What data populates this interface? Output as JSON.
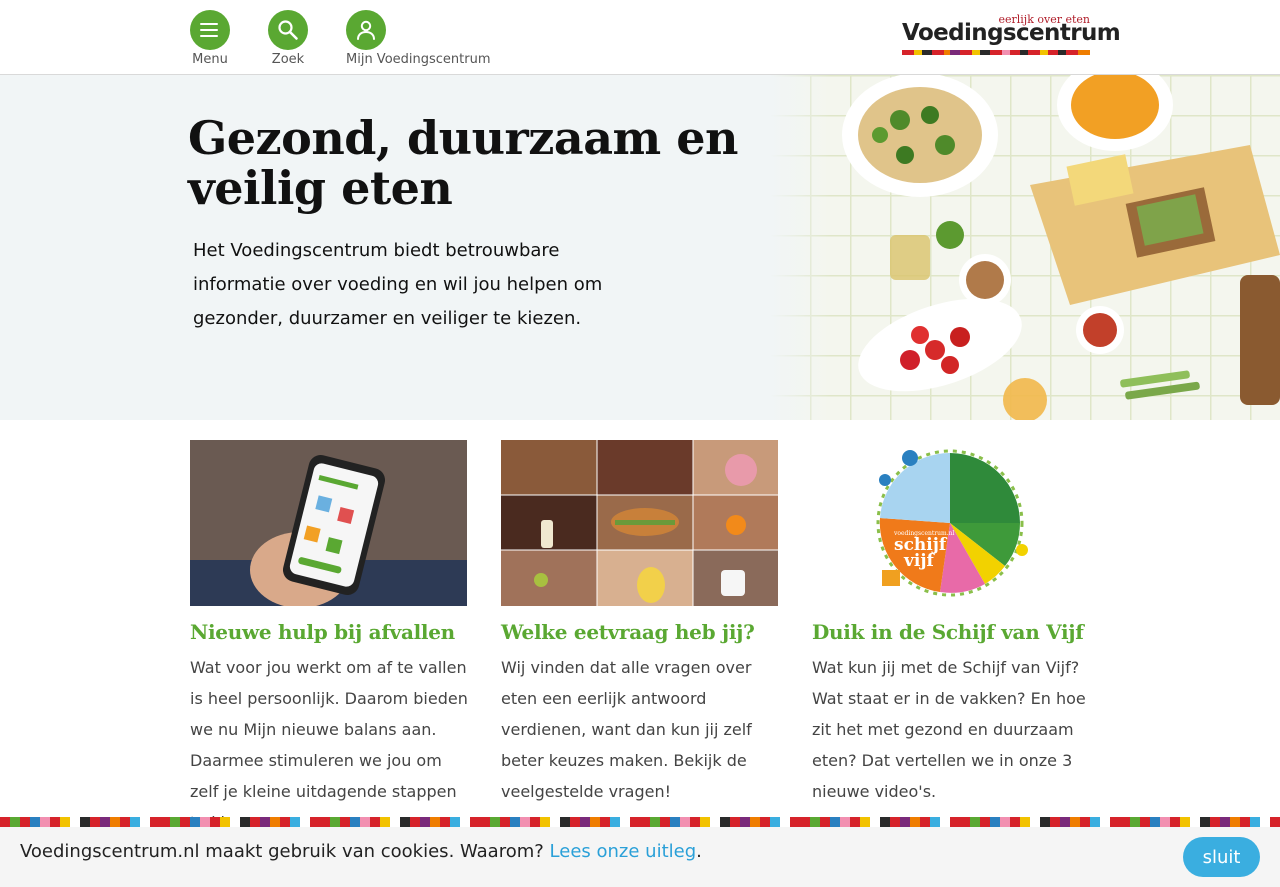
{
  "colors": {
    "brand_green": "#5aa832",
    "link_blue": "#2aa0d8",
    "button_blue": "#3aaee0",
    "logo_red": "#b01e2a"
  },
  "header": {
    "nav": [
      {
        "label": "Menu",
        "icon": "hamburger-icon"
      },
      {
        "label": "Zoek",
        "icon": "search-icon"
      },
      {
        "label": "Mijn Voedingscentrum",
        "icon": "user-icon"
      }
    ],
    "logo": {
      "tagline": "eerlijk over eten",
      "wordmark": "Voedingscentrum"
    }
  },
  "hero": {
    "title_line1": "Gezond, duurzaam en",
    "title_line2": "veilig eten",
    "text": "Het Voedingscentrum biedt betrouwbare informatie over voeding en wil jou helpen om gezonder, duurzamer en veiliger te kiezen."
  },
  "cards": [
    {
      "title": "Nieuwe hulp bij afvallen",
      "text": "Wat voor jou werkt om af te vallen is heel persoonlijk. Daarom bieden we nu Mijn nieuwe balans aan. Daarmee stimuleren we jou om zelf je kleine uitdagende stappen te kiezen."
    },
    {
      "title": "Welke eetvraag heb jij?",
      "text": "Wij vinden dat alle vragen over eten een eerlijk antwoord verdienen, want dan kun jij zelf beter keuzes maken. Bekijk de veelgestelde vragen!"
    },
    {
      "title": "Duik in de Schijf van Vijf",
      "text": "Wat kun jij met de Schijf van Vijf? Wat staat er in de vakken? En hoe zit het met gezond en duurzaam eten? Dat vertellen we in onze 3 nieuwe video's.",
      "disc_text_top": "voedingscentrum.nl",
      "disc_text_1": "schijf",
      "disc_text_2": "vijf"
    }
  ],
  "cookie": {
    "text": "Voedingscentrum.nl maakt gebruik van cookies. Waarom? ",
    "link": "Lees onze uitleg",
    "period": ".",
    "button": "sluit"
  }
}
